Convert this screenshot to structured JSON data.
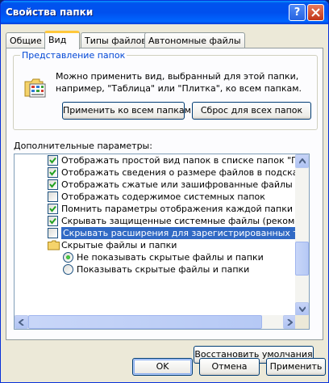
{
  "window": {
    "title": "Свойства папки",
    "help_label": "?"
  },
  "tabs": [
    {
      "label": "Общие"
    },
    {
      "label": "Вид"
    },
    {
      "label": "Типы файлов"
    },
    {
      "label": "Автономные файлы"
    }
  ],
  "folder_views": {
    "title": "Представление папок",
    "description": "Можно применить вид, выбранный для этой папки, например, \"Таблица\" или \"Плитка\", ко всем папкам.",
    "apply_all_label": "Применить ко всем папкам",
    "reset_all_label": "Сброс для всех папок"
  },
  "advanced": {
    "label": "Дополнительные параметры:",
    "items": [
      {
        "text": "Отображать простой вид папок в списке папок \"Проводни",
        "checked": true
      },
      {
        "text": "Отображать сведения о размере файлов в подсказках па",
        "checked": true
      },
      {
        "text": "Отображать сжатые или зашифрованные файлы NTFS др",
        "checked": true
      },
      {
        "text": "Отображать содержимое системных папок",
        "checked": false
      },
      {
        "text": "Помнить параметры отображения каждой папки",
        "checked": true
      },
      {
        "text": "Скрывать защищенные системные файлы (рекомендуетс",
        "checked": true
      },
      {
        "text": "Скрывать расширения для зарегистрированных типов фа",
        "checked": false,
        "selected": true
      }
    ],
    "hidden_folder": "Скрытые файлы и папки",
    "radios": [
      {
        "text": "Не показывать скрытые файлы и папки",
        "selected": true
      },
      {
        "text": "Показывать скрытые файлы и папки",
        "selected": false
      }
    ]
  },
  "restore_label": "Восстановить умолчания",
  "buttons": {
    "ok": "OK",
    "cancel": "Отмена",
    "apply": "Применить"
  },
  "colors": {
    "title_bar": "#0053ee",
    "selection": "#316ac5",
    "group_title": "#0046d5",
    "tab_highlight": "#ffc83c"
  }
}
